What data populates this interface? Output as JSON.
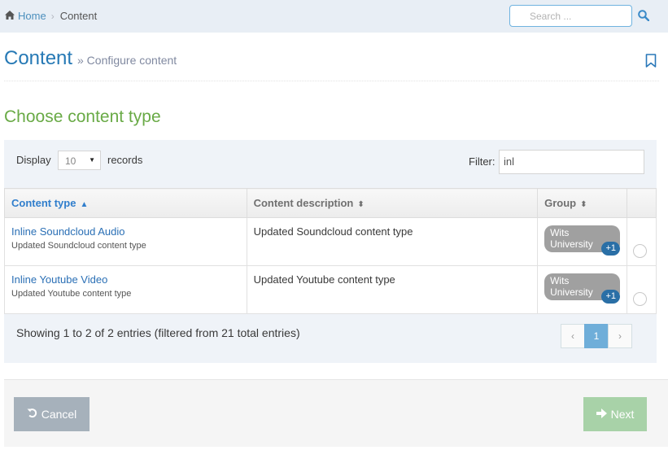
{
  "breadcrumb": {
    "home_label": "Home",
    "current_label": "Content"
  },
  "search": {
    "placeholder": "Search ..."
  },
  "header": {
    "title": "Content",
    "subtitle": "» Configure content"
  },
  "section": {
    "title": "Choose content type"
  },
  "table_controls": {
    "display_label": "Display",
    "records_value": "10",
    "records_label": "records",
    "filter_label": "Filter:",
    "filter_value": "inl"
  },
  "table": {
    "columns": {
      "content_type": "Content type",
      "content_description": "Content description",
      "group": "Group"
    },
    "rows": [
      {
        "name": "Inline Soundcloud Audio",
        "sub": "Updated Soundcloud content type",
        "description": "Updated Soundcloud content type",
        "group": "Wits University",
        "extra": "+1"
      },
      {
        "name": "Inline Youtube Video",
        "sub": "Updated Youtube content type",
        "description": "Updated Youtube content type",
        "group": "Wits University",
        "extra": "+1"
      }
    ]
  },
  "footer": {
    "info": "Showing 1 to 2 of 2 entries (filtered from 21 total entries)",
    "pagination": {
      "prev": "‹",
      "current": "1",
      "next": "›"
    }
  },
  "actions": {
    "cancel_label": "Cancel",
    "next_label": "Next"
  },
  "colors": {
    "accent_blue": "#2679b5",
    "section_green": "#69aa46",
    "cancel_grey": "#a6b1bb",
    "next_green": "#a8d2a8"
  },
  "icons": {
    "home": "home-icon",
    "search": "search-icon",
    "bookmark": "bookmark-icon",
    "undo": "undo-icon",
    "arrow_right": "arrow-right-icon"
  }
}
